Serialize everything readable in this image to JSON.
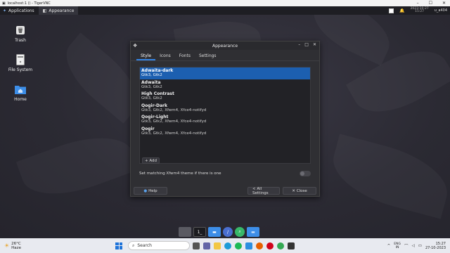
{
  "vnc": {
    "title": "localhost:1 () - TigerVNC"
  },
  "panel": {
    "apps_label": "Applications",
    "task_label": "Appearance",
    "clock": "2023-10-27\n15:27",
    "user": "u_a404"
  },
  "desktop": {
    "icons": [
      {
        "label": "Trash"
      },
      {
        "label": "File System"
      },
      {
        "label": "Home"
      }
    ]
  },
  "dialog": {
    "title": "Appearance",
    "tabs": [
      "Style",
      "Icons",
      "Fonts",
      "Settings"
    ],
    "themes": [
      {
        "name": "Adwaita-dark",
        "sub": "Gtk3, Gtk2",
        "selected": true
      },
      {
        "name": "Adwaita",
        "sub": "Gtk3, Gtk2",
        "selected": false
      },
      {
        "name": "High Contrast",
        "sub": "Gtk3, Gtk2",
        "selected": false
      },
      {
        "name": "Qogir-Dark",
        "sub": "Gtk3, Gtk2, Xfwm4, Xfce4-notifyd",
        "selected": false
      },
      {
        "name": "Qogir-Light",
        "sub": "Gtk3, Gtk2, Xfwm4, Xfce4-notifyd",
        "selected": false
      },
      {
        "name": "Qogir",
        "sub": "Gtk3, Gtk2, Xfwm4, Xfce4-notifyd",
        "selected": false
      }
    ],
    "add_label": "+ Add",
    "match_label": "Set matching Xfwm4 theme if there is one",
    "match_enabled": false,
    "help_label": "Help",
    "all_settings_label": "< All Settings",
    "close_label": "Close"
  },
  "taskbar": {
    "temp": "26°C",
    "weather": "Haze",
    "search": "Search",
    "lang_top": "ENG",
    "lang_bottom": "IN",
    "time": "15:27",
    "date": "27-10-2023"
  },
  "colors": {
    "accent": "#1c5fb0",
    "panel": "#1e1e23",
    "dialog": "#2f2f33"
  }
}
